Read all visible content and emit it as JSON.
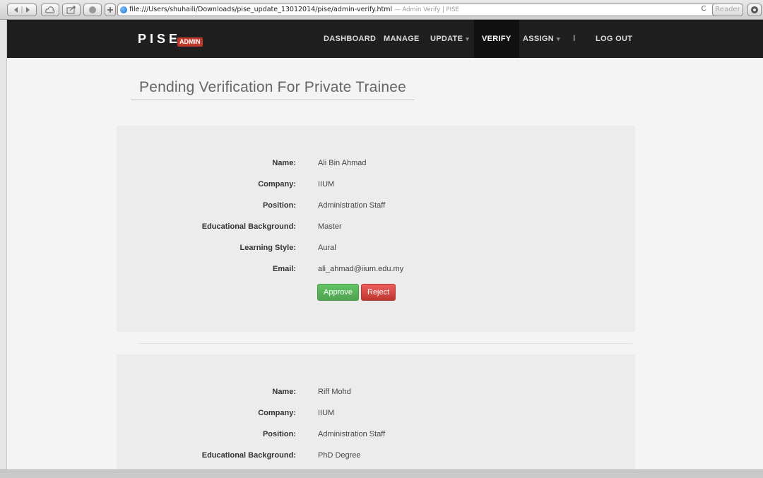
{
  "browser": {
    "url": "file:///Users/shuhaili/Downloads/pise_update_13012014/pise/admin-verify.html",
    "tab_title": "— Admin Verify | PISE",
    "reader_label": "Reader",
    "reload_glyph": "C"
  },
  "navbar": {
    "brand": "PISE",
    "badge": "ADMIN",
    "items": [
      {
        "label": "DASHBOARD"
      },
      {
        "label": "MANAGE"
      },
      {
        "label": "UPDATE"
      },
      {
        "label": "VERIFY"
      },
      {
        "label": "ASSIGN"
      },
      {
        "label": "LOG OUT"
      }
    ],
    "caret": "▾",
    "separator": "I"
  },
  "page": {
    "title": "Pending Verification For Private Trainee"
  },
  "labels": {
    "name": "Name:",
    "company": "Company:",
    "position": "Position:",
    "education": "Educational Background:",
    "learning": "Learning Style:",
    "email": "Email:"
  },
  "trainees": [
    {
      "name": "Ali Bin Ahmad",
      "company": "IIUM",
      "position": "Administration Staff",
      "education": "Master",
      "learning": "Aural",
      "email": "ali_ahmad@iium.edu.my"
    },
    {
      "name": "Riff Mohd",
      "company": "IIUM",
      "position": "Administration Staff",
      "education": "PhD Degree"
    }
  ],
  "actions": {
    "approve": "Approve",
    "reject": "Reject"
  },
  "colors": {
    "approve": "#5bb75b",
    "reject": "#da4f49",
    "navbar": "#1f1f1f",
    "badge": "#c0392b"
  }
}
